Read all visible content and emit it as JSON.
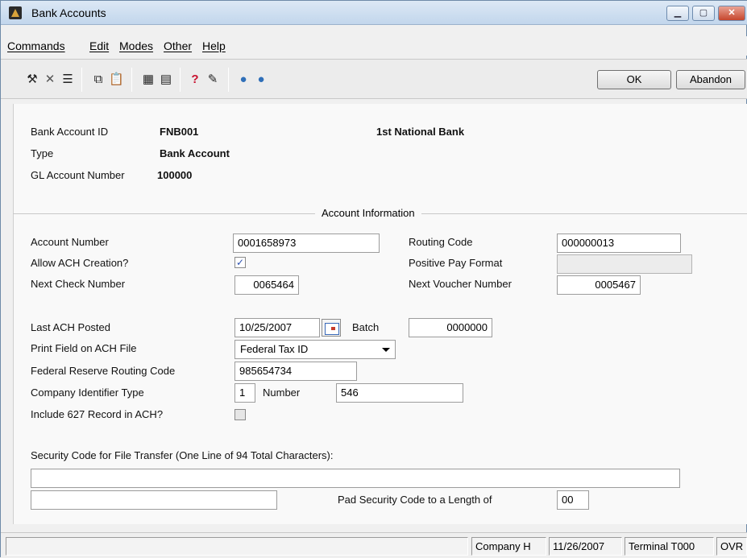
{
  "window": {
    "title": "Bank Accounts"
  },
  "menu": {
    "commands": "Commands",
    "edit": "Edit",
    "modes": "Modes",
    "other": "Other",
    "help": "Help"
  },
  "toolbar": {
    "ok": "OK",
    "abandon": "Abandon"
  },
  "header": {
    "bank_account_id_label": "Bank Account ID",
    "bank_account_id": "FNB001",
    "bank_name": "1st National Bank",
    "type_label": "Type",
    "type_value": "Bank Account",
    "gl_label": "GL Account Number",
    "gl_value": "100000"
  },
  "account_info": {
    "section_title": "Account Information",
    "account_number_label": "Account Number",
    "account_number": "0001658973",
    "routing_code_label": "Routing Code",
    "routing_code": "000000013",
    "allow_ach_label": "Allow ACH Creation?",
    "allow_ach_checked": true,
    "positive_pay_label": "Positive Pay Format",
    "positive_pay_value": "",
    "next_check_label": "Next Check Number",
    "next_check": "0065464",
    "next_voucher_label": "Next Voucher Number",
    "next_voucher": "0005467",
    "last_ach_label": "Last ACH Posted",
    "last_ach_date": "10/25/2007",
    "batch_label": "Batch",
    "batch_value": "0000000",
    "print_field_label": "Print Field on ACH File",
    "print_field_value": "Federal Tax ID",
    "fed_reserve_label": "Federal Reserve Routing Code",
    "fed_reserve_value": "985654734",
    "company_id_type_label": "Company Identifier Type",
    "company_id_type_value": "1",
    "number_label": "Number",
    "number_value": "546",
    "include_627_label": "Include 627 Record in ACH?",
    "include_627_checked": false,
    "security_code_label": "Security Code for File Transfer (One Line of 94 Total Characters):",
    "security_line1": "",
    "security_line2": "",
    "pad_label": "Pad Security Code to a Length of",
    "pad_value": "00"
  },
  "status": {
    "company": "Company H",
    "date": "11/26/2007",
    "terminal": "Terminal T000",
    "mode": "OVR"
  },
  "icons": [
    "tools-icon",
    "delete-icon",
    "list-icon",
    "copy-icon",
    "paste-icon",
    "calculator-icon",
    "calendar-icon",
    "help-icon",
    "book-icon",
    "back-globe-icon",
    "forward-globe-icon"
  ]
}
